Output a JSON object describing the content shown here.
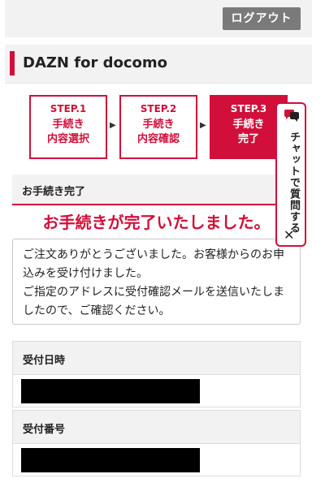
{
  "header": {
    "logout_label": "ログアウト"
  },
  "page": {
    "title": "DAZN for docomo"
  },
  "steps": [
    {
      "number": "STEP.1",
      "label_line1": "手続き",
      "label_line2": "内容選択",
      "active": false
    },
    {
      "number": "STEP.2",
      "label_line1": "手続き",
      "label_line2": "内容確認",
      "active": false
    },
    {
      "number": "STEP.3",
      "label_line1": "手続き",
      "label_line2": "完了",
      "active": true
    }
  ],
  "chat": {
    "label": "チャットで質問する",
    "close": "✕",
    "icon": "chat-bubble-icon"
  },
  "section": {
    "heading": "お手続き完了",
    "message": "お手続きが完了いたしました。",
    "notice_line1": "ご注文ありがとうございました。お客様からのお申込みを受け付けました。",
    "notice_line2": "ご指定のアドレスに受付確認メールを送信いたしましたので、ご確認ください。"
  },
  "info": {
    "reception_datetime_label": "受付日時",
    "reception_number_label": "受付番号"
  },
  "colors": {
    "accent": "#d10f3a",
    "panel": "#f2f2f2",
    "button": "#7a7a7a"
  }
}
